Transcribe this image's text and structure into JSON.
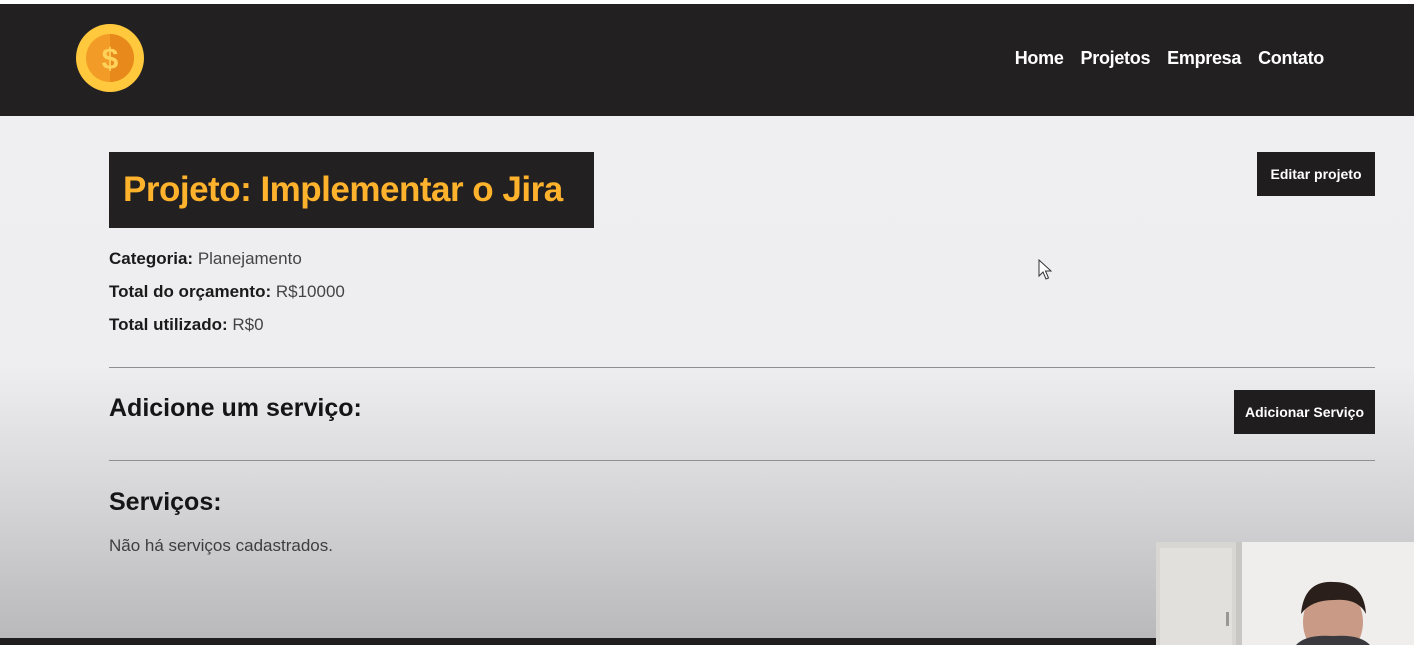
{
  "nav": {
    "links": [
      "Home",
      "Projetos",
      "Empresa",
      "Contato"
    ]
  },
  "logo": {
    "icon": "coin-dollar-icon",
    "symbol": "$",
    "colors": {
      "outer": "#ffc83d",
      "inner": "#f29b26"
    }
  },
  "project": {
    "title": "Projeto: Implementar o Jira",
    "edit_button": "Editar projeto",
    "category_label": "Categoria:",
    "category_value": "Planejamento",
    "budget_label": "Total do orçamento:",
    "budget_value": "R$10000",
    "used_label": "Total utilizado:",
    "used_value": "R$0"
  },
  "add_service": {
    "heading": "Adicione um serviço:",
    "button": "Adicionar Serviço"
  },
  "services": {
    "heading": "Serviços:",
    "empty_text": "Não há serviços cadastrados."
  },
  "colors": {
    "navbar": "#222021",
    "title_text": "#ffb22c",
    "button_bg": "#1f1d1e"
  }
}
